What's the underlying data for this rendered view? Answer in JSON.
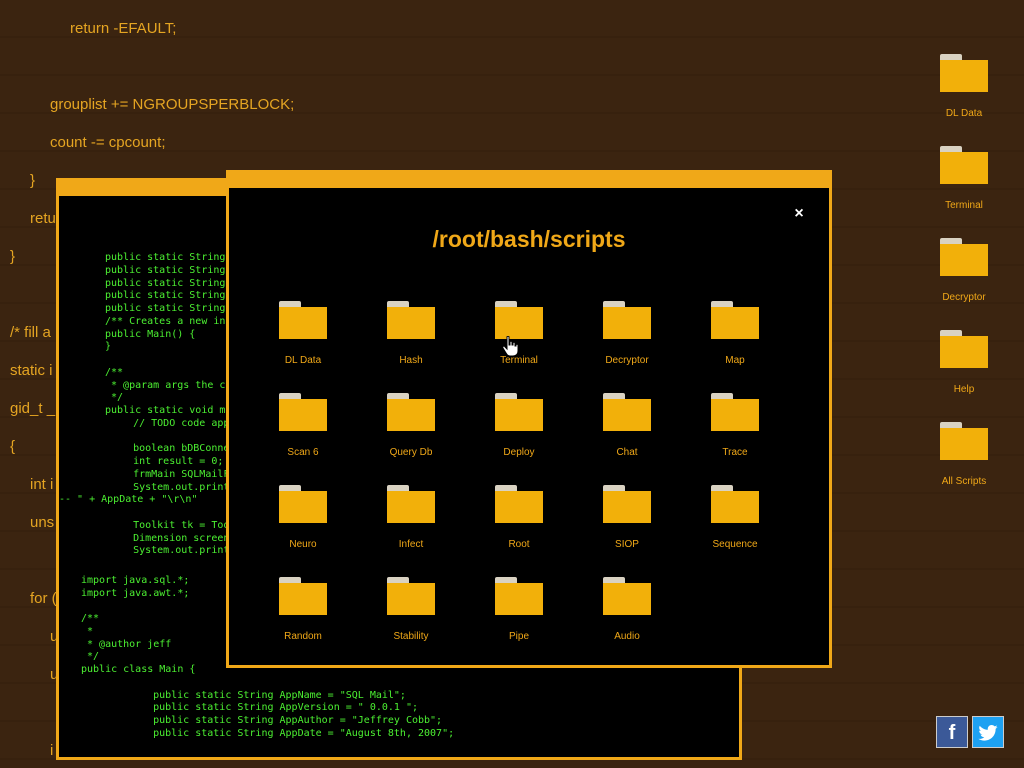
{
  "background_code": [
    "return -EFAULT;",
    "grouplist += NGROUPSPERBLOCK;",
    "count -= cpcount;",
    "}",
    "retu",
    "}",
    "/* fill a",
    "static i",
    "gid_t _",
    "{",
    "int i",
    "uns",
    "for (",
    "u",
    "u",
    "i"
  ],
  "terminal": {
    "lines": [
      "public static String",
      "public static String",
      "public static String",
      "public static String",
      "public static String",
      "/** Creates a new in",
      "public Main() {",
      "}",
      "",
      "/**",
      " * @param args the c",
      " */",
      "public static void m",
      "    // TODO code app",
      "",
      "    boolean bDBConne",
      "    int result = 0;",
      "    frmMain SQLMailF",
      "    System.out.print",
      "-- \" + AppDate + \"\\r\\n\"",
      "",
      "    Toolkit tk = Too",
      "    Dimension screen",
      "    System.out.print",
      "",
      "import java.sql.*;",
      "import java.awt.*;",
      "",
      "/**",
      " *",
      " * @author jeff",
      " */",
      "public class Main {",
      "",
      "    public static String AppName = \"SQL Mail\";",
      "    public static String AppVersion = \" 0.0.1 \";",
      "    public static String AppAuthor = \"Jeffrey Cobb\";",
      "    public static String AppDate = \"August 8th, 2007\";"
    ]
  },
  "modal": {
    "title": "/root/bash/scripts",
    "close_label": "×",
    "folders": [
      "DL Data",
      "Hash",
      "Terminal",
      "Decryptor",
      "Map",
      "Scan 6",
      "Query Db",
      "Deploy",
      "Chat",
      "Trace",
      "Neuro",
      "Infect",
      "Root",
      "SIOP",
      "Sequence",
      "Random",
      "Stability",
      "Pipe",
      "Audio"
    ]
  },
  "desktop_icons": [
    "DL Data",
    "Terminal",
    "Decryptor",
    "Help",
    "All Scripts"
  ],
  "social": {
    "facebook": "f",
    "twitter": "twitter-bird-icon"
  },
  "colors": {
    "accent": "#f0a818",
    "folder": "#f2b00a",
    "terminal_text": "#4cf032",
    "background": "#3b2410"
  }
}
